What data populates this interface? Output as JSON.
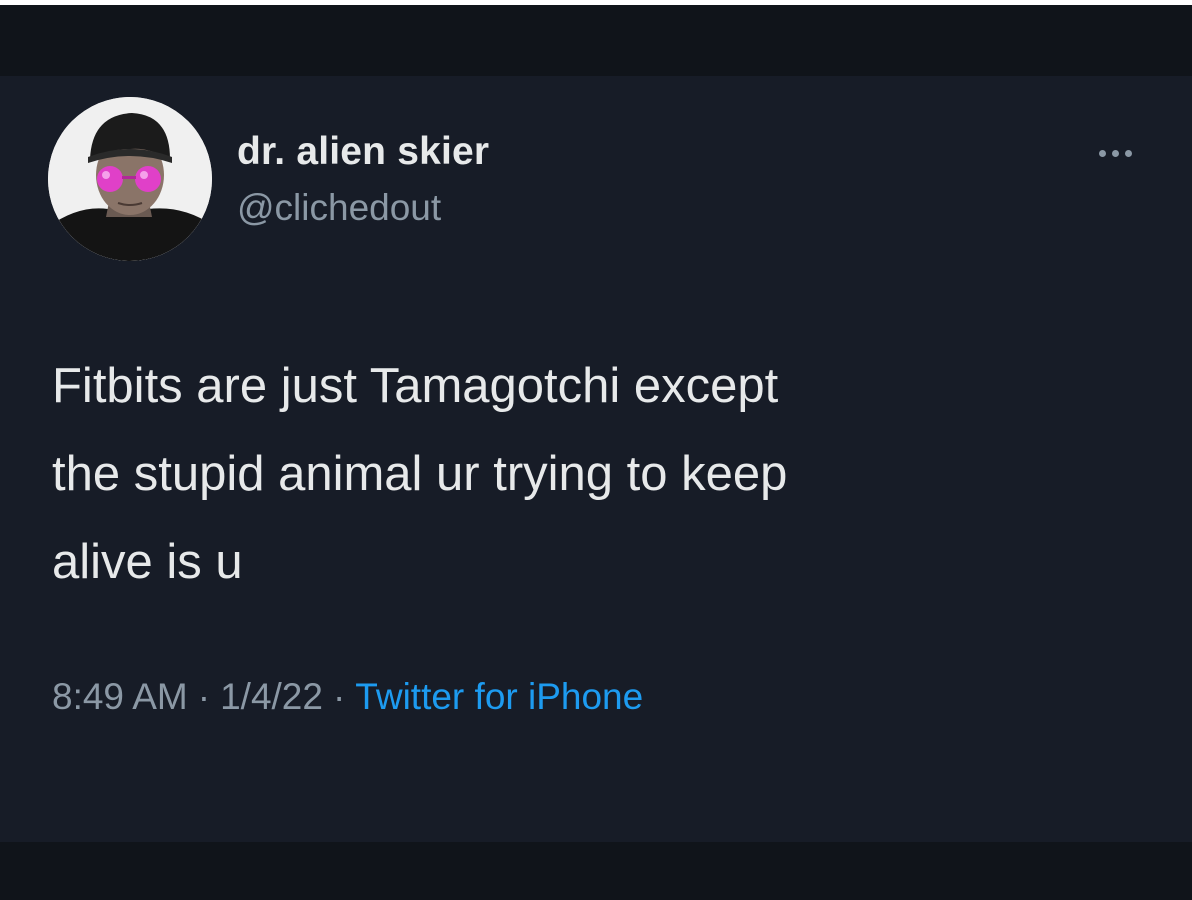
{
  "tweet": {
    "author": {
      "display_name": "dr. alien skier",
      "handle": "@clichedout",
      "avatar_icon": "profile-photo-avatar"
    },
    "more_icon": "ellipsis-icon",
    "text_lines": [
      "Fitbits are just Tamagotchi except",
      "the stupid animal ur trying to keep",
      "alive is u"
    ],
    "time": "8:49 AM",
    "date": "1/4/22",
    "separator": "·",
    "source": "Twitter for iPhone"
  },
  "colors": {
    "background": "#171c27",
    "border_dark": "#10141a",
    "text_primary": "#e7e9ea",
    "text_secondary": "#8b98a5",
    "link": "#1d9bf0",
    "avatar_glasses": "#e040c8"
  }
}
